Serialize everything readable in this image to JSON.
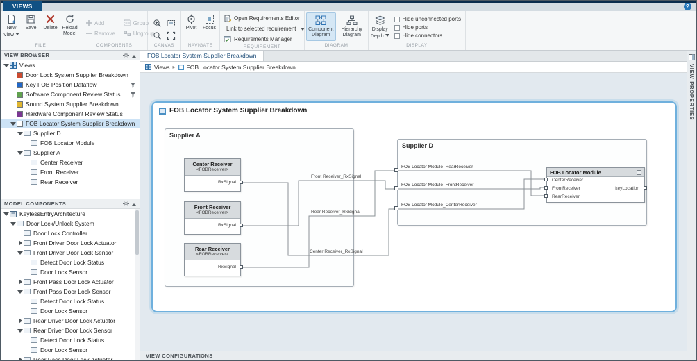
{
  "titlebar": {
    "tab": "VIEWS",
    "help": "?"
  },
  "icons": {
    "dropdown_caret": "▾",
    "crumb_sep": "▸"
  },
  "ribbon": {
    "file": {
      "label": "FILE",
      "new1": "New",
      "new2": "View",
      "save": "Save",
      "delete": "Delete",
      "reload1": "Reload",
      "reload2": "Model"
    },
    "components": {
      "label": "COMPONENTS",
      "add": "Add",
      "remove": "Remove",
      "group": "Group",
      "ungroup": "Ungroup"
    },
    "canvas": {
      "label": "CANVAS"
    },
    "navigate": {
      "label": "NAVIGATE",
      "pivot": "Pivot",
      "focus": "Focus"
    },
    "requirement": {
      "label": "REQUIREMENT",
      "open_editor": "Open Requirements Editor",
      "link": "Link to selected requirement",
      "manager": "Requirements Manager"
    },
    "diagram": {
      "label": "DIAGRAM",
      "comp1": "Component",
      "comp2": "Diagram",
      "hier1": "Hierarchy",
      "hier2": "Diagram"
    },
    "display": {
      "label": "DISPLAY",
      "depth1": "Display",
      "depth2": "Depth",
      "cb1": "Hide unconnected ports",
      "cb2": "Hide ports",
      "cb3": "Hide connectors"
    }
  },
  "doc": {
    "tab": "FOB Locator System Supplier Breakdown",
    "crumb_root": "Views",
    "crumb_current": "FOB Locator System Supplier Breakdown"
  },
  "view_browser": {
    "title": "VIEW BROWSER",
    "items": [
      {
        "label": "Views"
      },
      {
        "label": "Door Lock System Supplier Breakdown",
        "color": "#cc4b30"
      },
      {
        "label": "Key FOB Position Dataflow",
        "color": "#2268c8"
      },
      {
        "label": "Software Component Review Status",
        "color": "#61a24f"
      },
      {
        "label": "Sound System Supplier Breakdown",
        "color": "#e0b62f"
      },
      {
        "label": "Hardware Component Review Status",
        "color": "#7b3793"
      },
      {
        "label": "FOB Locator System Supplier Breakdown",
        "color": "#ffffff",
        "selected": true
      },
      {
        "label": "Supplier D"
      },
      {
        "label": "FOB Locator Module"
      },
      {
        "label": "Supplier A"
      },
      {
        "label": "Center Receiver"
      },
      {
        "label": "Front Receiver"
      },
      {
        "label": "Rear Receiver"
      }
    ]
  },
  "model_components": {
    "title": "MODEL COMPONENTS",
    "items": [
      {
        "label": "KeylessEntryArchitecture"
      },
      {
        "label": "Door Lock/Unlock System"
      },
      {
        "label": "Door Lock Controller"
      },
      {
        "label": "Front Driver Door Lock Actuator"
      },
      {
        "label": "Front Driver Door Lock Sensor"
      },
      {
        "label": "Detect Door Lock Status"
      },
      {
        "label": "Door Lock Sensor"
      },
      {
        "label": "Front Pass Door Lock Actuator"
      },
      {
        "label": "Front Pass Door Lock Sensor"
      },
      {
        "label": "Detect Door Lock Status"
      },
      {
        "label": "Door Lock Sensor"
      },
      {
        "label": "Rear Driver Door Lock Actuator"
      },
      {
        "label": "Rear Driver Door Lock Sensor"
      },
      {
        "label": "Detect Door Lock Status"
      },
      {
        "label": "Door Lock Sensor"
      },
      {
        "label": "Rear Pass Door Lock Actuator"
      }
    ]
  },
  "diagram_view": {
    "title": "FOB Locator System Supplier Breakdown",
    "supplier_a": {
      "title": "Supplier A",
      "components": [
        {
          "name": "Center Receiver",
          "stereotype": "<FOBReceiver>",
          "port": "RxSignal"
        },
        {
          "name": "Front Receiver",
          "stereotype": "<FOBReceiver>",
          "port": "RxSignal"
        },
        {
          "name": "Rear Receiver",
          "stereotype": "<FOBReceiver>",
          "port": "RxSignal"
        }
      ]
    },
    "supplier_d": {
      "title": "Supplier D",
      "edge_ports": [
        "FOB Locator Module_RearReceiver",
        "FOB Locator Module_FrontReceiver",
        "FOB Locator Module_CenterReceiver"
      ],
      "module": {
        "name": "FOB Locator Module",
        "in_ports": [
          "CenterReceiver",
          "FrontReceiver",
          "RearReceiver"
        ],
        "out_port": "keyLocation"
      }
    },
    "signals": [
      "Front Receiver_RxSignal",
      "Rear Receiver_RxSignal",
      "Center Receiver_RxSignal"
    ]
  },
  "panels": {
    "view_properties": "VIEW PROPERTIES",
    "view_configurations": "VIEW CONFIGURATIONS"
  }
}
